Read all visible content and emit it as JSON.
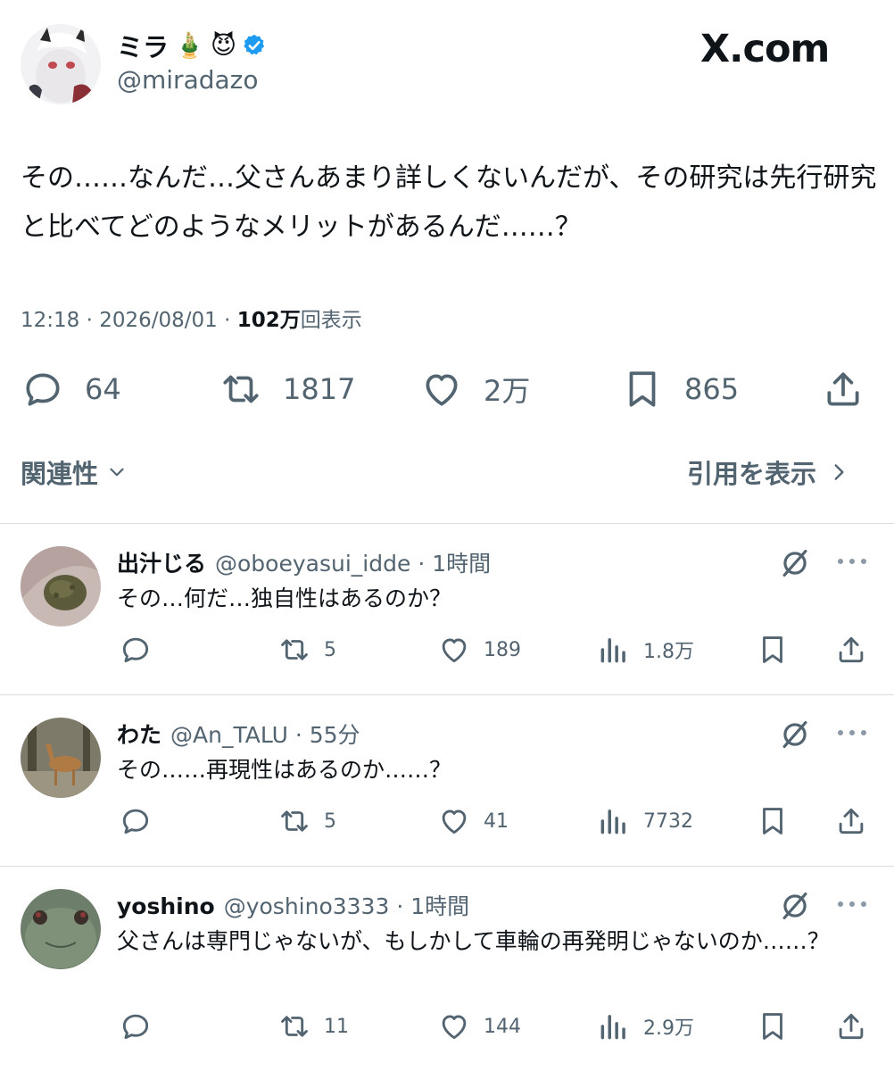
{
  "author": {
    "display_name": "ミラ",
    "emoji_1": "🎍",
    "emoji_2": "😈",
    "handle": "@miradazo",
    "verified": true
  },
  "watermark": "X.com",
  "post": {
    "text": "その……なんだ…父さんあまり詳しくないんだが、その研究は先行研究と比べてどのようなメリットがあるんだ……？",
    "time": "12:18 · 2026/08/01 · ",
    "views_count": "102万",
    "views_label": "回表示"
  },
  "actions": {
    "replies": "64",
    "reposts": "1817",
    "likes": "2万",
    "bookmarks": "865"
  },
  "filters": {
    "relevance_label": "関連性",
    "quotes_label": "引用を表示"
  },
  "replies": [
    {
      "name": "出汁じる",
      "handle": "@oboeyasui_idde",
      "time": "· 1時間",
      "text": "その…何だ…独自性はあるのか？",
      "reposts": "5",
      "likes": "189",
      "views": "1.8万"
    },
    {
      "name": "わた",
      "handle": "@An_TALU",
      "time": "· 55分",
      "text": "その……再現性はあるのか……？",
      "reposts": "5",
      "likes": "41",
      "views": "7732"
    },
    {
      "name": "yoshino",
      "handle": "@yoshino3333",
      "time": "· 1時間",
      "text": "父さんは専門じゃないが、もしかして車輪の再発明じゃないのか……？",
      "reposts": "11",
      "likes": "144",
      "views": "2.9万"
    }
  ],
  "colors": {
    "text": "#0f1419",
    "muted": "#536471",
    "verified": "#1d9bf0",
    "divider": "#d9dde1"
  }
}
